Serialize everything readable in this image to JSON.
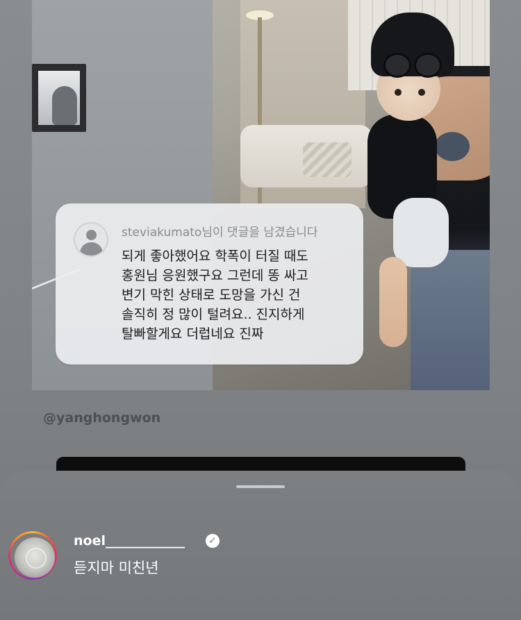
{
  "comment": {
    "header": "steviakumato님이 댓글을 남겼습니다",
    "lines": [
      "되게 좋아했어요 학폭이 터질 때도",
      "홍원님 응원했구요 그런데 똥 싸고",
      "변기 막힌 상태로 도망을 가신 건",
      "솔직히 정 많이 털려요.. 진지하게",
      "탈빠할게요 더럽네요 진짜"
    ]
  },
  "post": {
    "handle": "@yanghongwon"
  },
  "reply": {
    "username": "noel____________",
    "text": "듣지마 미친년",
    "verified": true
  },
  "icons": {
    "verified": "verified-badge-icon",
    "avatar": "default-user-avatar-icon"
  }
}
